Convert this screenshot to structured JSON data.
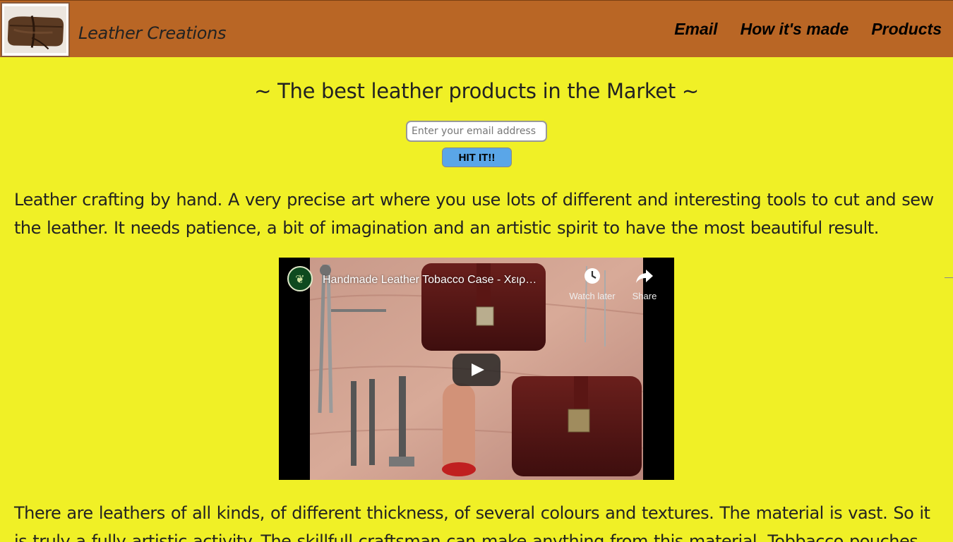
{
  "header": {
    "brand": "Leather Creations",
    "nav": [
      "Email",
      "How it's made",
      "Products"
    ]
  },
  "tagline": "~ The best leather products in the Market ~",
  "signup": {
    "email_placeholder": "Enter your email address",
    "button_label": "HIT IT!!"
  },
  "content": {
    "paragraph1": "Leather crafting by hand. A very precise art where you use lots of different and interesting tools to cut and sew the leather. It needs patience, a bit of imagination and an artistic spirit to have the most beautiful result.",
    "paragraph2": "There are leathers of all kinds, of different thickness, of several colours and textures. The material is vast. So it is truly a fully artistic activity. The skillfull craftsman can make anything from this material. Tobbacco pouches,"
  },
  "video": {
    "title": "Handmade Leather Tobacco Case - Χειρ…",
    "watch_later_label": "Watch later",
    "share_label": "Share",
    "icons": [
      "clock-icon",
      "share-arrow-icon",
      "play-icon"
    ]
  },
  "colors": {
    "page_bg": "#f0f026",
    "header_bg": "#b96625",
    "button_bg": "#5aa6e8"
  }
}
